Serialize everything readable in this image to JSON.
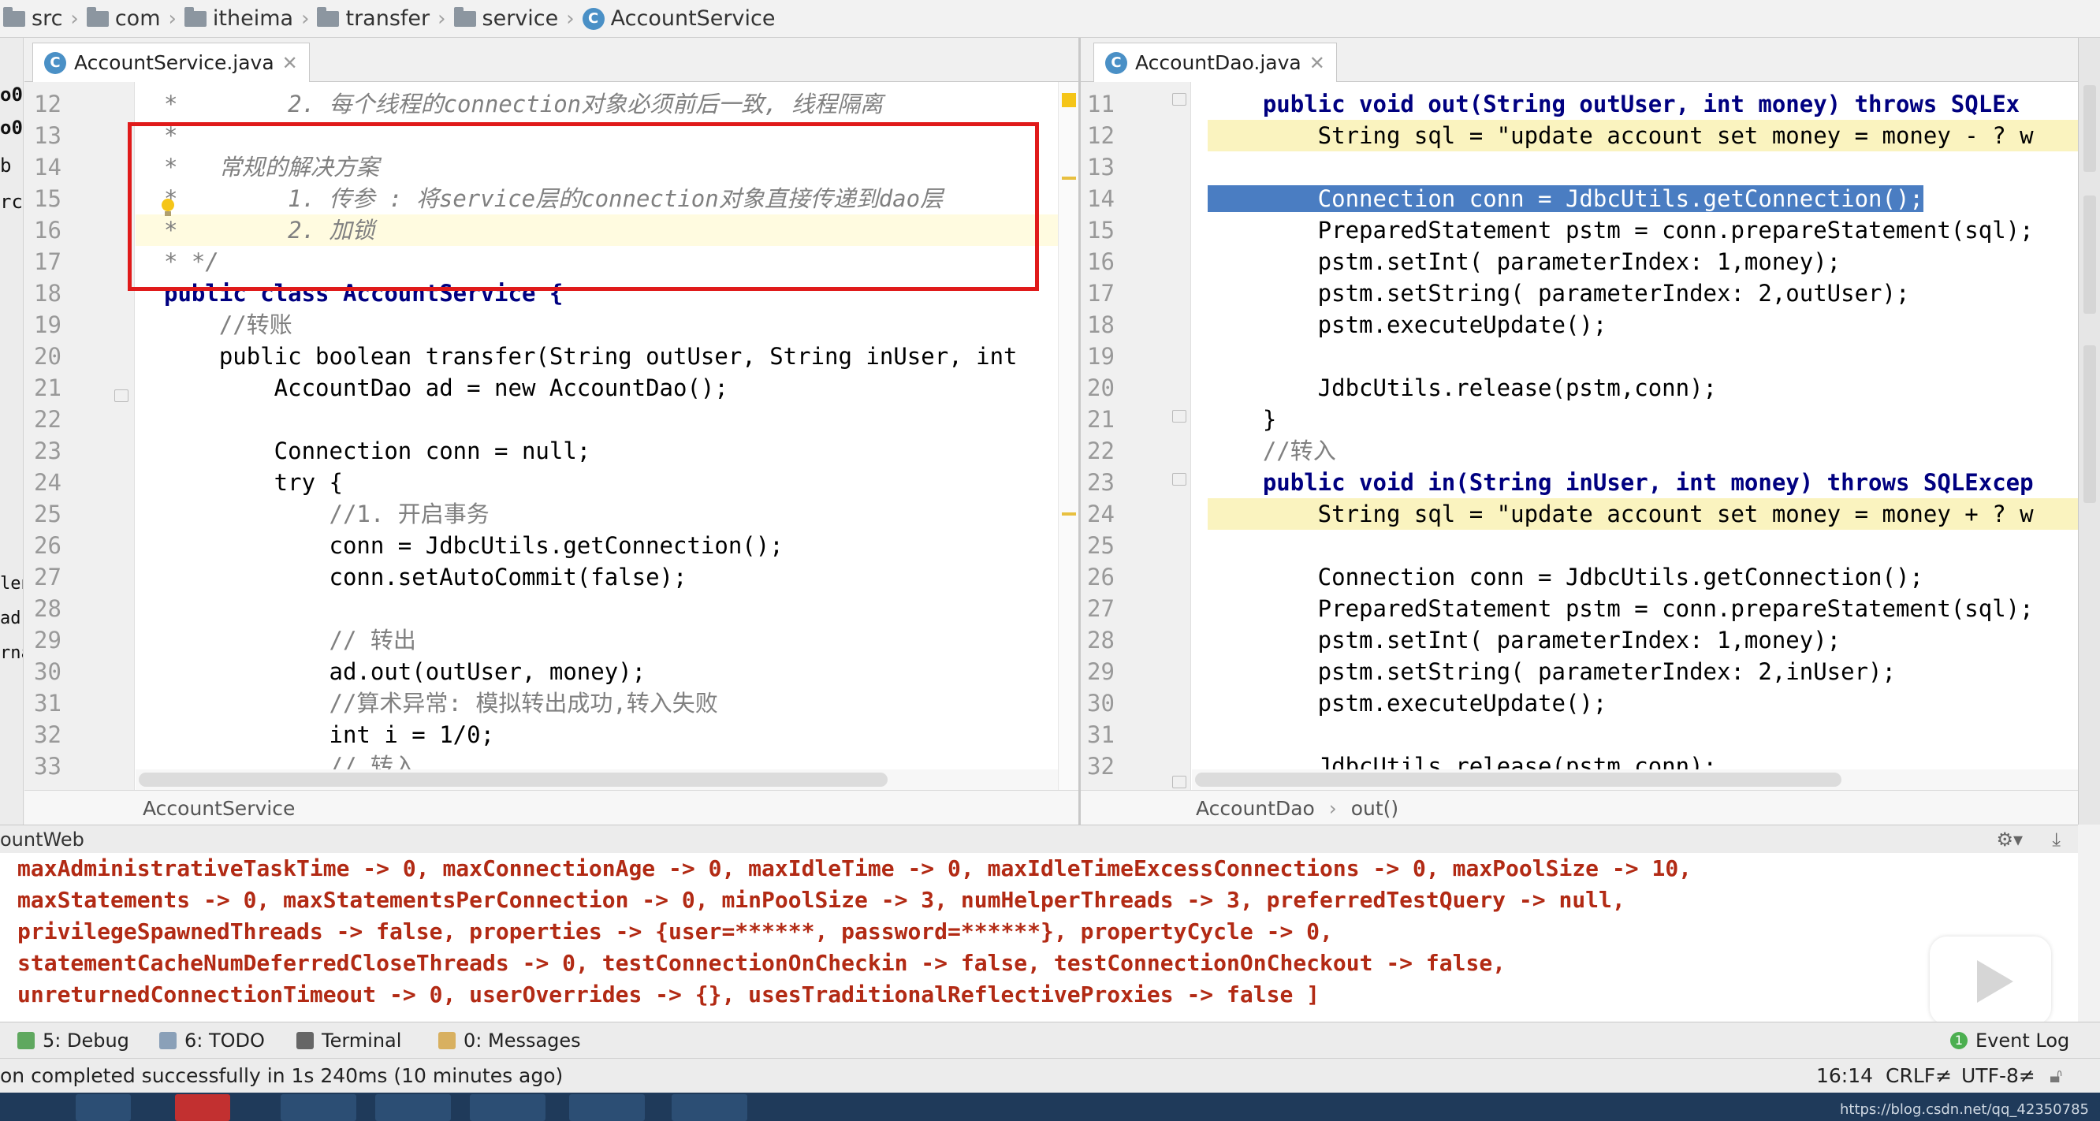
{
  "breadcrumb": [
    "src",
    "com",
    "itheima",
    "transfer",
    "service",
    "AccountService"
  ],
  "left_partial": [
    "o0",
    "o0",
    "b",
    "rc",
    "len",
    "ad",
    "rna"
  ],
  "left_editor": {
    "tab": "AccountService.java",
    "crumb": "AccountService",
    "lines": [
      {
        "n": "12",
        "text": "*        2. 每个线程的connection对象必须前后一致, 线程隔离"
      },
      {
        "n": "13",
        "text": "*"
      },
      {
        "n": "14",
        "text": "*   常规的解决方案"
      },
      {
        "n": "15",
        "text": "*        1. 传参 : 将service层的connection对象直接传递到dao层"
      },
      {
        "n": "16",
        "text": "*        2. 加锁"
      },
      {
        "n": "17",
        "text": "* */"
      },
      {
        "n": "18",
        "text": "public class AccountService {"
      },
      {
        "n": "19",
        "text": "    //转账"
      },
      {
        "n": "20",
        "text": "    public boolean transfer(String outUser, String inUser, int"
      },
      {
        "n": "21",
        "text": "        AccountDao ad = new AccountDao();"
      },
      {
        "n": "22",
        "text": ""
      },
      {
        "n": "23",
        "text": "        Connection conn = null;"
      },
      {
        "n": "24",
        "text": "        try {"
      },
      {
        "n": "25",
        "text": "            //1. 开启事务"
      },
      {
        "n": "26",
        "text": "            conn = JdbcUtils.getConnection();"
      },
      {
        "n": "27",
        "text": "            conn.setAutoCommit(false);"
      },
      {
        "n": "28",
        "text": ""
      },
      {
        "n": "29",
        "text": "            // 转出"
      },
      {
        "n": "30",
        "text": "            ad.out(outUser, money);"
      },
      {
        "n": "31",
        "text": "            //算术异常: 模拟转出成功,转入失败"
      },
      {
        "n": "32",
        "text": "            int i = 1/0;"
      },
      {
        "n": "33",
        "text": "            // 转入"
      }
    ]
  },
  "right_editor": {
    "tab": "AccountDao.java",
    "crumb": [
      "AccountDao",
      "out()"
    ],
    "lines": [
      {
        "n": "11",
        "text": "    public void out(String outUser, int money) throws SQLEx"
      },
      {
        "n": "12",
        "text": "        String sql = \"update account set money = money - ? w"
      },
      {
        "n": "13",
        "text": ""
      },
      {
        "n": "14",
        "text": "        Connection conn = JdbcUtils.getConnection();"
      },
      {
        "n": "15",
        "text": "        PreparedStatement pstm = conn.prepareStatement(sql);"
      },
      {
        "n": "16",
        "text": "        pstm.setInt( parameterIndex: 1,money);"
      },
      {
        "n": "17",
        "text": "        pstm.setString( parameterIndex: 2,outUser);"
      },
      {
        "n": "18",
        "text": "        pstm.executeUpdate();"
      },
      {
        "n": "19",
        "text": ""
      },
      {
        "n": "20",
        "text": "        JdbcUtils.release(pstm,conn);"
      },
      {
        "n": "21",
        "text": "    }"
      },
      {
        "n": "22",
        "text": "    //转入"
      },
      {
        "n": "23",
        "text": "    public void in(String inUser, int money) throws SQLExcep"
      },
      {
        "n": "24",
        "text": "        String sql = \"update account set money = money + ? w"
      },
      {
        "n": "25",
        "text": ""
      },
      {
        "n": "26",
        "text": "        Connection conn = JdbcUtils.getConnection();"
      },
      {
        "n": "27",
        "text": "        PreparedStatement pstm = conn.prepareStatement(sql);"
      },
      {
        "n": "28",
        "text": "        pstm.setInt( parameterIndex: 1,money);"
      },
      {
        "n": "29",
        "text": "        pstm.setString( parameterIndex: 2,inUser);"
      },
      {
        "n": "30",
        "text": "        pstm.executeUpdate();"
      },
      {
        "n": "31",
        "text": ""
      },
      {
        "n": "32",
        "text": "        JdbcUtils.release(pstm,conn);"
      }
    ]
  },
  "run": {
    "title": "ountWeb",
    "console": [
      "maxAdministrativeTaskTime -> 0, maxConnectionAge -> 0, maxIdleTime -> 0, maxIdleTimeExcessConnections -> 0, maxPoolSize -> 10,",
      "maxStatements -> 0, maxStatementsPerConnection -> 0, minPoolSize -> 3, numHelperThreads -> 3, preferredTestQuery -> null,",
      "privilegeSpawnedThreads -> false, properties -> {user=******, password=******}, propertyCycle -> 0,",
      "statementCacheNumDeferredCloseThreads -> 0, testConnectionOnCheckin -> false, testConnectionOnCheckout -> false,",
      "unreturnedConnectionTimeout -> 0, userOverrides -> {}, usesTraditionalReflectiveProxies -> false ]"
    ]
  },
  "toolbar": {
    "debug": "5: Debug",
    "todo": "6: TODO",
    "terminal": "Terminal",
    "messages": "0: Messages",
    "eventlog": "Event Log",
    "eventlog_count": "1"
  },
  "status": {
    "message": "on completed successfully in 1s 240ms (10 minutes ago)",
    "position": "16:14",
    "line_sep": "CRLF≠",
    "encoding": "UTF-8≠"
  },
  "watermark": "https://blog.csdn.net/qq_42350785"
}
